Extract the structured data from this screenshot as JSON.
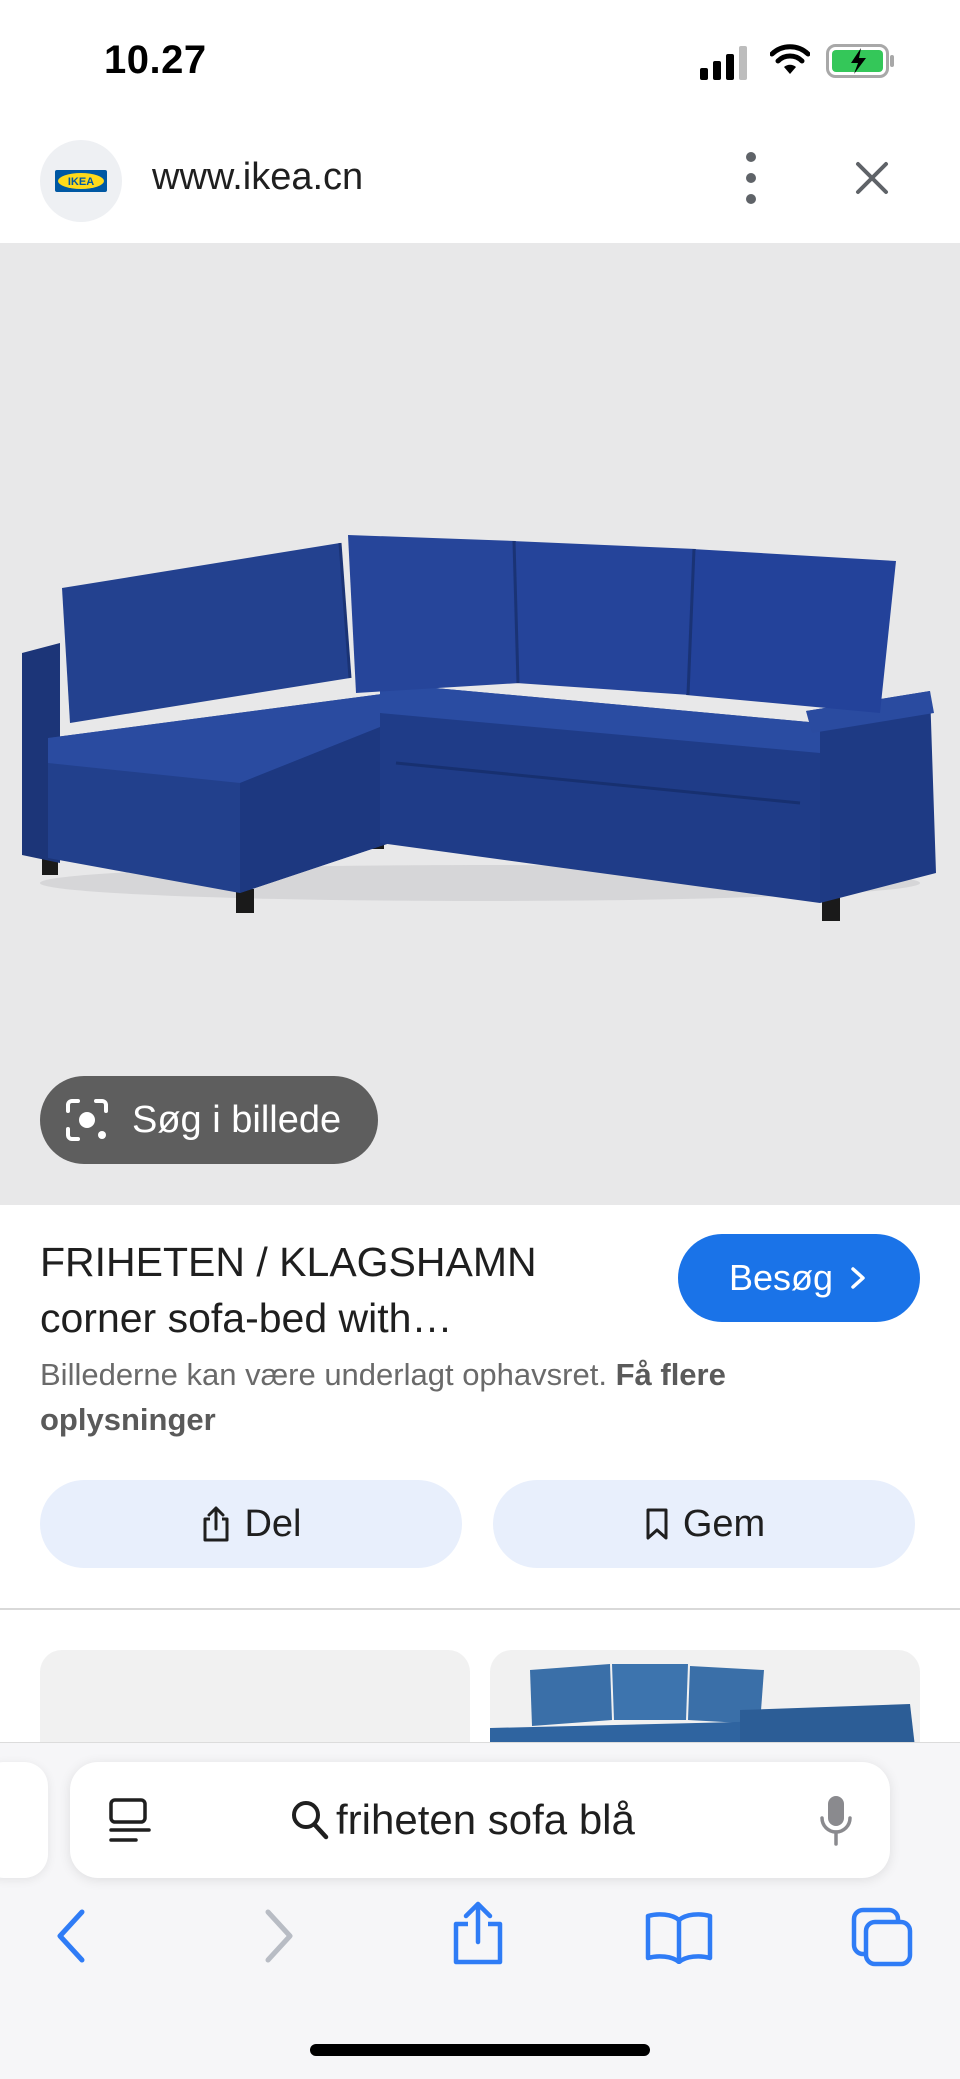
{
  "status_bar": {
    "time": "10.27"
  },
  "browser": {
    "url": "www.ikea.cn",
    "favicon_label": "IKEA"
  },
  "image_viewer": {
    "lens_label": "Søg i billede",
    "product_title": "FRIHETEN / KLAGSHAMN corner sofa-bed with…",
    "visit_label": "Besøg",
    "copyright_text": "Billederne kan være underlagt ophavsret.",
    "copyright_link": "Få flere oplysninger",
    "share_label": "Del",
    "save_label": "Gem"
  },
  "safari": {
    "search_query": "friheten sofa blå"
  },
  "colors": {
    "accent": "#1a73e8",
    "pill_bg": "#e8effc",
    "safari_blue": "#2f7cf6",
    "sofa_blue": "#1f3c8a"
  },
  "icons": [
    "signal-icon",
    "wifi-icon",
    "battery-charging-icon",
    "ikea-logo",
    "more-vert-icon",
    "close-icon",
    "lens-icon",
    "chevron-right-icon",
    "share-icon",
    "bookmark-icon",
    "reader-icon",
    "search-icon",
    "mic-icon",
    "back-arrow-icon",
    "forward-arrow-icon",
    "share-toolbar-icon",
    "bookmarks-icon",
    "tabs-icon"
  ]
}
